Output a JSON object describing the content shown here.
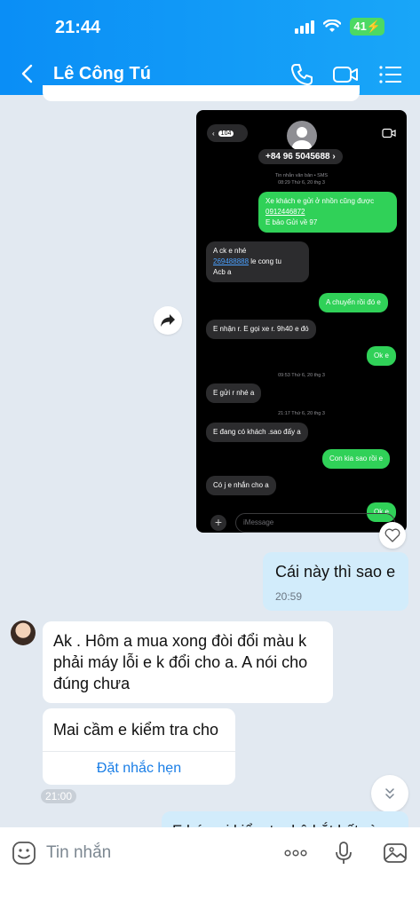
{
  "status": {
    "time": "21:44",
    "battery": "41"
  },
  "header": {
    "contact_name": "Lê Công Tú"
  },
  "screenshot": {
    "back_count": "104",
    "phone_number": "+84 96 5045688",
    "meta_top": "Tin nhắn văn bản • SMS",
    "meta_top_date": "08:29 Thứ 6, 20 thg 3",
    "m1_line1": "Xe khách e gửi ở nhồn cũng được",
    "m1_phone": "0912446872",
    "m1_line3": "E bảo Gửi về 97",
    "m2_line1": "A ck e nhé",
    "m2_account": "269488888",
    "m2_account_suffix": " le cong tu",
    "m2_line3": "Acb a",
    "m3": "A chuyển rồi đó e",
    "m4": "E nhận r. E gọi xe r. 9h40 e đó",
    "m5": "Ok e",
    "meta_mid": "09:53 Thứ 6, 20 thg 3",
    "m6": "E gửi r nhé a",
    "meta_mid2": "21:17 Thứ 6, 20 thg 3",
    "m7": "E đang có khách .sao đấy a",
    "m8": "Con kia sao rồi e",
    "m9": "Có j e nhắn cho a",
    "m10": "Ok e",
    "imessage_placeholder": "iMessage"
  },
  "messages": {
    "out1_text": "Cái này thì sao e",
    "out1_time": "20:59",
    "in1_text": "Ak . Hôm a mua xong đòi đổi màu k phải máy lỗi e k đổi cho a. A nói cho đúng chưa",
    "in2_text": "Mai cầm e kiểm tra cho",
    "in2_action": "Đặt nhắc hẹn",
    "in2_time": "21:00",
    "out2_partial": "E hứa ai kiểm tra hộ bắt bất gì"
  },
  "composer": {
    "placeholder": "Tin nhắn"
  },
  "colors": {
    "header_start": "#0a8ef6",
    "header_end": "#19a6f8",
    "outgoing_bubble": "#d2ecfb",
    "imessage_green": "#30d158"
  }
}
